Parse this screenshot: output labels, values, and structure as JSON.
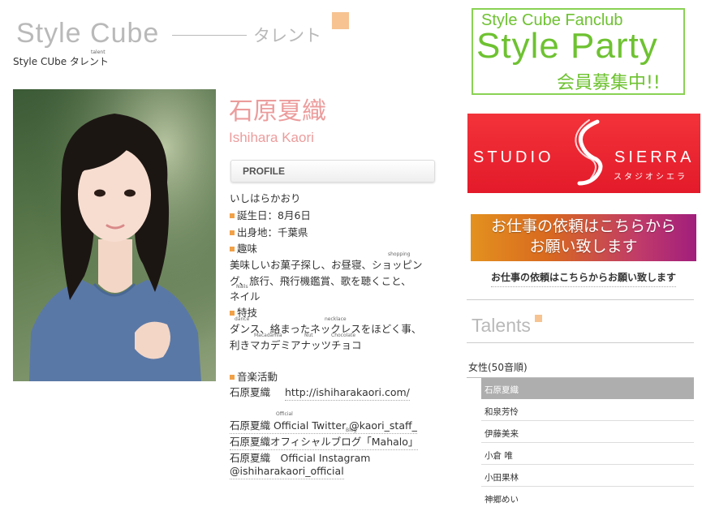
{
  "header": {
    "site_title": "Style Cube",
    "site_sub": "タレント",
    "breadcrumb_text": "Style CUbe タレント",
    "breadcrumb_ruby": "talent"
  },
  "profile": {
    "name_jp": "石原夏織",
    "name_en": "Ishihara Kaori",
    "section_label": "PROFILE",
    "reading": "いしはらかおり",
    "birthday": "誕生日：8月6日",
    "birthplace": "出身地：千葉県",
    "hobby_label": "趣味",
    "hobby_ruby_shopping": "shopping",
    "hobby_line1": "美味しいお菓子探し、お昼寝、ショッピン",
    "hobby_line2": "グ、旅行、飛行機鑑賞、歌を聴くこと、",
    "hobby_ruby_nails": "Nails",
    "hobby_line3": "ネイル",
    "skill_label": "特技",
    "skill_ruby_dance": "dance",
    "skill_ruby_necklace": "necklace",
    "skill_line1": "ダンス、絡まったネックレスをほどく事、",
    "skill_ruby_macadamia": "Macadamia",
    "skill_ruby_nut": "Nut",
    "skill_ruby_chocolate": "Chocolate",
    "skill_line2": "利きマカデミアナッツチョコ",
    "music_label": "音楽活動",
    "music_name": "石原夏織",
    "music_url": "http://ishiharakaori.com/",
    "twitter_text": "石原夏織 Official Twitter @kaori_staff_",
    "twitter_ruby": "Official",
    "blog_ruby": "Blog",
    "blog_text": "石原夏織オフィシャルブログ「Mahalo」",
    "instagram_text": "石原夏織　Official Instagram",
    "instagram_handle": "@ishiharakaori_official"
  },
  "sidebar": {
    "fanclub_line1": "Style Cube Fanclub",
    "fanclub_line2": "Style Party",
    "fanclub_line3": "会員募集中!!",
    "studio_left": "STUDIO",
    "studio_right": "SIERRA",
    "studio_kana": "スタジオシエラ",
    "work_banner_line1": "お仕事の依頼はこちらから",
    "work_banner_line2": "お願い致します",
    "work_link": "お仕事の依頼はこちらからお願い致します",
    "talents_title": "Talents",
    "category_label": "女性(50音順)",
    "talents": [
      {
        "name": "石原夏織",
        "active": true
      },
      {
        "name": "和泉芳怜",
        "active": false
      },
      {
        "name": "伊藤美来",
        "active": false
      },
      {
        "name": "小倉 唯",
        "active": false
      },
      {
        "name": "小田果林",
        "active": false
      },
      {
        "name": "神郷めい",
        "active": false
      }
    ]
  },
  "colors": {
    "accent_pink": "#ec9c9c",
    "accent_orange": "#f1a148",
    "fanclub_green": "#6ec231",
    "studio_red": "#e31a2a"
  }
}
